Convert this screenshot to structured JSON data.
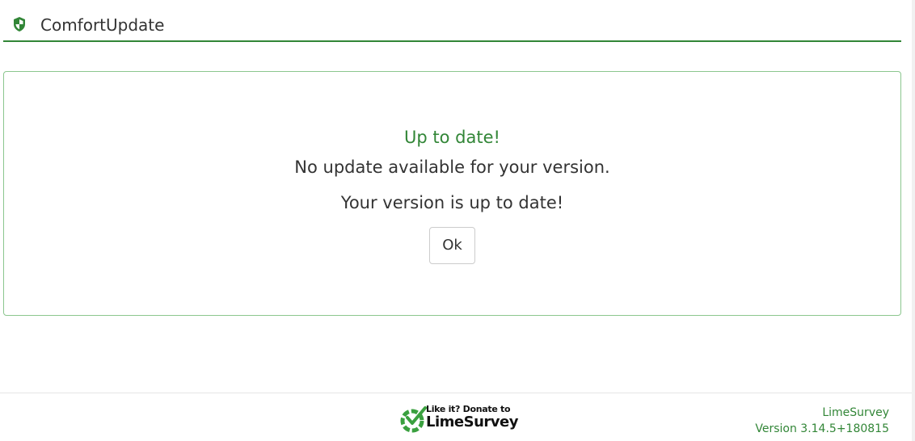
{
  "header": {
    "title": "ComfortUpdate",
    "icon": "shield-icon"
  },
  "status": {
    "heading": "Up to date!",
    "line1": "No update available for your version.",
    "line2": "Your version is up to date!",
    "ok_label": "Ok"
  },
  "footer": {
    "donate": {
      "small_text": "Like it? Donate to",
      "brand_text": "LimeSurvey",
      "icon": "limesurvey-logo-icon"
    },
    "brand_link": "LimeSurvey",
    "version": "Version 3.14.5+180815"
  },
  "colors": {
    "accent": "#328637",
    "panel_border": "#8bc68e",
    "text": "#333333"
  }
}
